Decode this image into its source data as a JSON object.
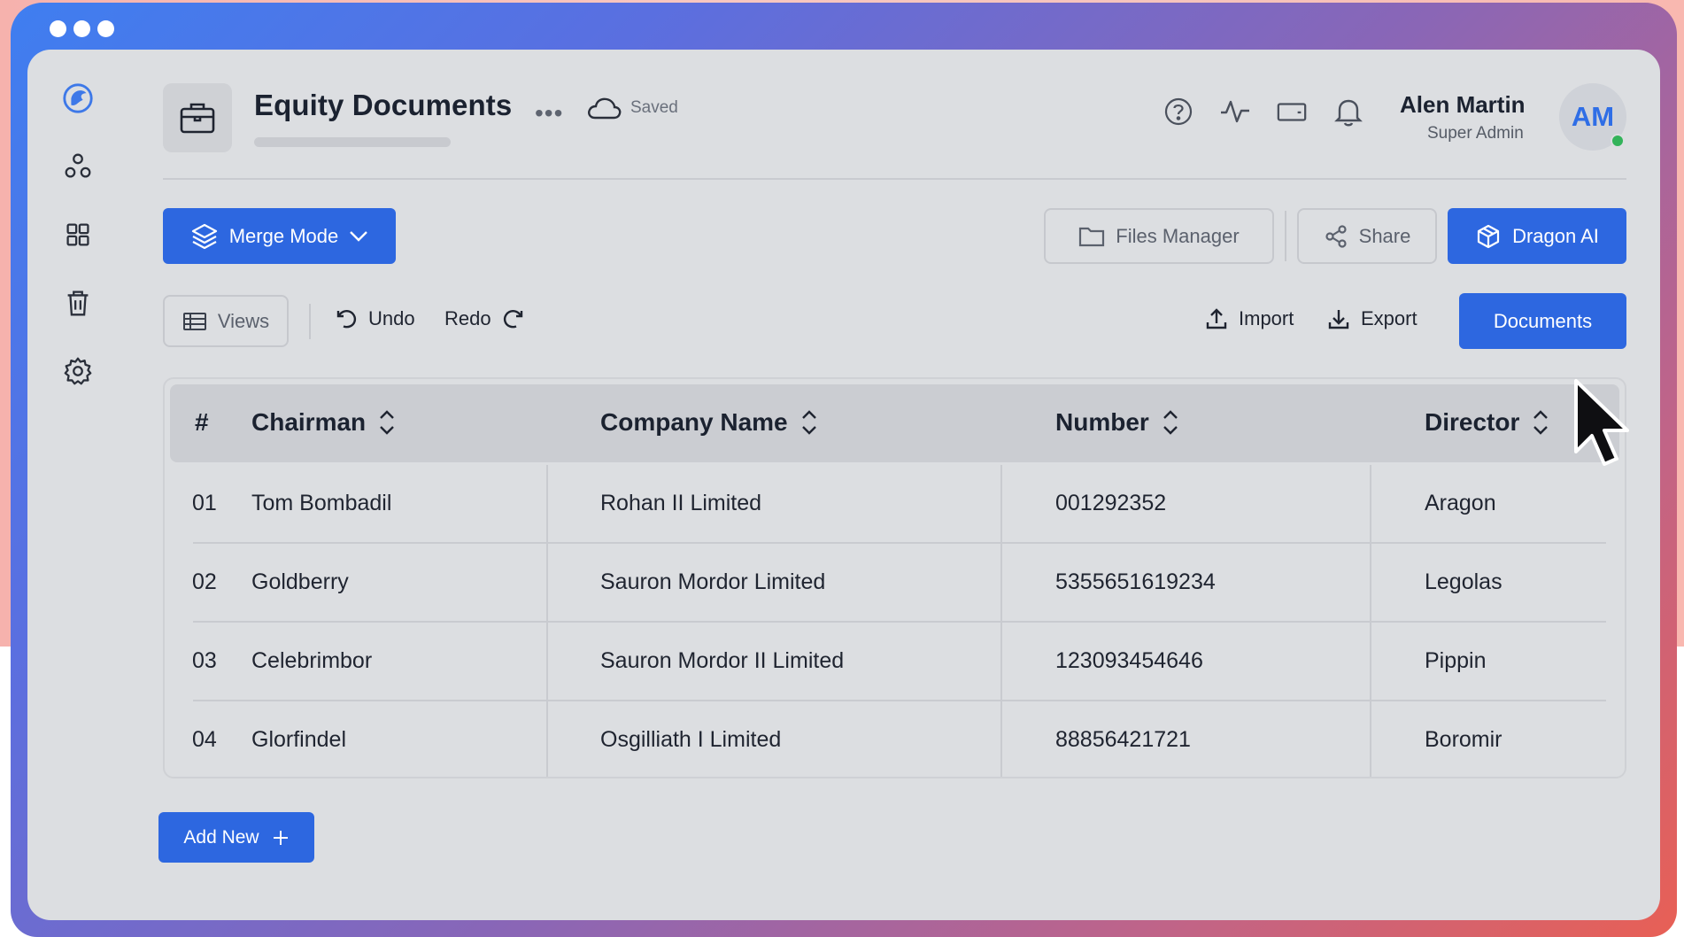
{
  "window": {
    "controls": [
      "dot",
      "dot",
      "dot"
    ]
  },
  "sidebar": {
    "items": [
      {
        "name": "logo-icon"
      },
      {
        "name": "users-icon"
      },
      {
        "name": "grid-icon"
      },
      {
        "name": "trash-icon"
      },
      {
        "name": "settings-icon"
      }
    ]
  },
  "header": {
    "title": "Equity Documents",
    "more": "•••",
    "status": "Saved",
    "icons": [
      "help-icon",
      "activity-icon",
      "wallet-icon",
      "bell-icon"
    ],
    "user": {
      "name": "Alen Martin",
      "role": "Super Admin",
      "initials": "AM",
      "online": true
    }
  },
  "toolbar": {
    "merge_mode": "Merge Mode",
    "files_manager": "Files Manager",
    "share": "Share",
    "dragon_ai": "Dragon AI",
    "views": "Views",
    "undo": "Undo",
    "redo": "Redo",
    "import": "Import",
    "export": "Export",
    "documents": "Documents"
  },
  "table": {
    "columns": [
      "#",
      "Chairman",
      "Company Name",
      "Number",
      "Director"
    ],
    "rows": [
      [
        "01",
        "Tom Bombadil",
        "Rohan II Limited",
        "001292352",
        "Aragon"
      ],
      [
        "02",
        "Goldberry",
        "Sauron Mordor Limited",
        "5355651619234",
        "Legolas"
      ],
      [
        "03",
        "Celebrimbor",
        "Sauron Mordor II Limited",
        "123093454646",
        "Pippin"
      ],
      [
        "04",
        "Glorfindel",
        "Osgilliath I Limited",
        "88856421721",
        "Boromir"
      ]
    ]
  },
  "footer": {
    "add_new": "Add New"
  },
  "colors": {
    "primary": "#2d67e0",
    "background": "#dcdee1",
    "online": "#33b35a"
  }
}
